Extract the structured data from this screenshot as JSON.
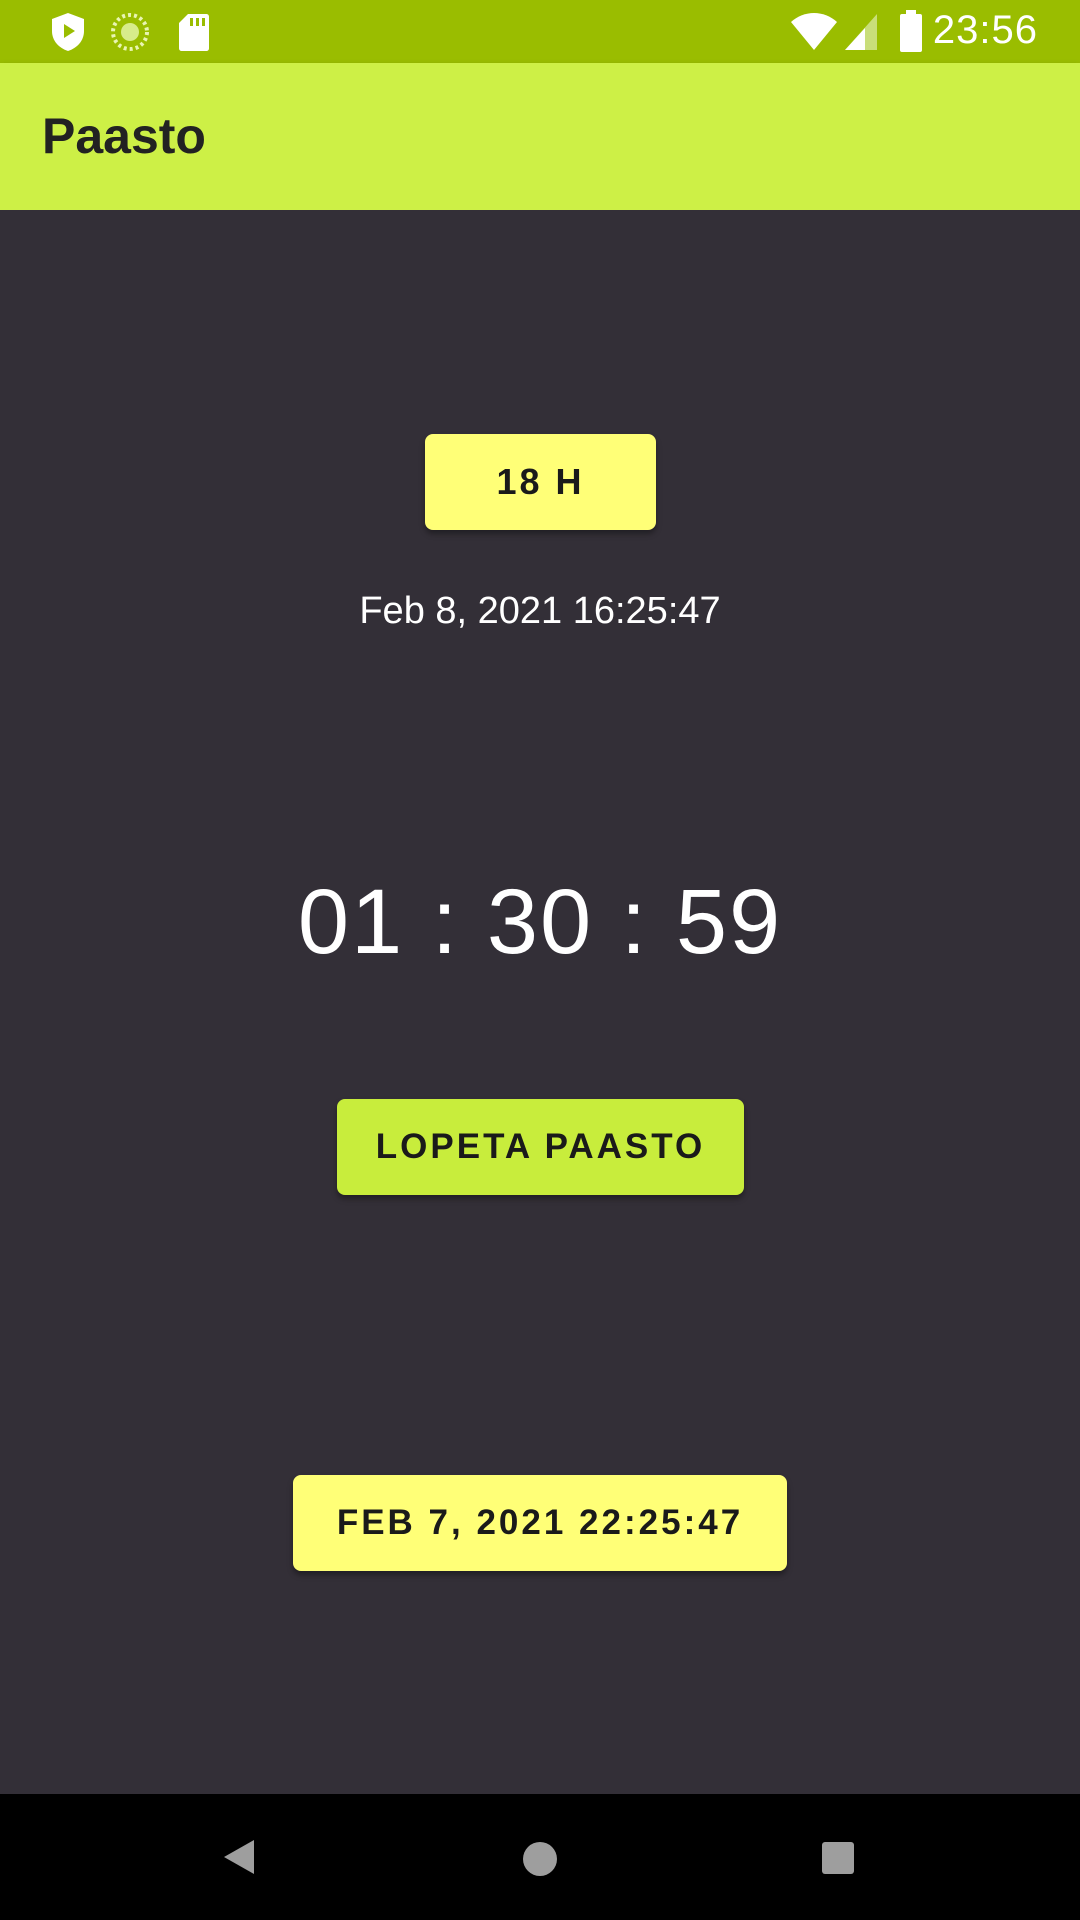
{
  "status_bar": {
    "time": "23:56",
    "icons": [
      "shield-play-icon",
      "sync-icon",
      "sd-card-icon",
      "wifi-icon",
      "signal-icon",
      "battery-icon"
    ]
  },
  "app_bar": {
    "title": "Paasto"
  },
  "main": {
    "duration_button": "18 H",
    "end_datetime": "Feb 8, 2021 16:25:47",
    "timer": "01 : 30 : 59",
    "stop_button": "LOPETA PAASTO",
    "start_datetime_button": "FEB 7, 2021 22:25:47"
  },
  "nav_bar": {
    "icons": [
      "back-icon",
      "home-icon",
      "recents-icon"
    ]
  },
  "colors": {
    "status_bar": "#9abd00",
    "app_bar": "#cdf046",
    "background": "#332f37",
    "yellow_button": "#ffff77",
    "green_button": "#c8ed3c"
  }
}
